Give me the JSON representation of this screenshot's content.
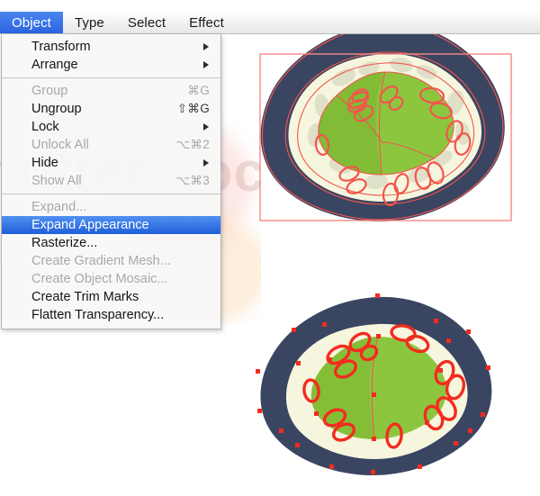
{
  "app": {
    "colors": {
      "menubar_highlight": "#2c63e0",
      "menu_selected": "#1f5fd8",
      "artwork_navy": "#3a4562",
      "artwork_cream": "#f6f6df",
      "artwork_green": "#8cc63f",
      "artwork_green_dark": "#7ab32e",
      "artwork_olive": "#dcddc4",
      "path_red": "#f4554c",
      "bbox_red": "#f58a85",
      "anchor_red": "#f42b1e"
    }
  },
  "menubar": {
    "items": [
      {
        "label": "Object",
        "active": true
      },
      {
        "label": "Type",
        "active": false
      },
      {
        "label": "Select",
        "active": false
      },
      {
        "label": "Effect",
        "active": false
      }
    ]
  },
  "object_menu": {
    "groups": [
      {
        "items": [
          {
            "label": "Transform",
            "shortcut": "",
            "submenu": true,
            "disabled": false,
            "selected": false
          },
          {
            "label": "Arrange",
            "shortcut": "",
            "submenu": true,
            "disabled": false,
            "selected": false
          }
        ]
      },
      {
        "items": [
          {
            "label": "Group",
            "shortcut": "⌘G",
            "submenu": false,
            "disabled": true,
            "selected": false
          },
          {
            "label": "Ungroup",
            "shortcut": "⇧⌘G",
            "submenu": false,
            "disabled": false,
            "selected": false
          },
          {
            "label": "Lock",
            "shortcut": "",
            "submenu": true,
            "disabled": false,
            "selected": false
          },
          {
            "label": "Unlock All",
            "shortcut": "⌥⌘2",
            "submenu": false,
            "disabled": true,
            "selected": false
          },
          {
            "label": "Hide",
            "shortcut": "",
            "submenu": true,
            "disabled": false,
            "selected": false
          },
          {
            "label": "Show All",
            "shortcut": "⌥⌘3",
            "submenu": false,
            "disabled": true,
            "selected": false
          }
        ]
      },
      {
        "items": [
          {
            "label": "Expand...",
            "shortcut": "",
            "submenu": false,
            "disabled": true,
            "selected": false
          },
          {
            "label": "Expand Appearance",
            "shortcut": "",
            "submenu": false,
            "disabled": false,
            "selected": true
          },
          {
            "label": "Rasterize...",
            "shortcut": "",
            "submenu": false,
            "disabled": false,
            "selected": false
          },
          {
            "label": "Create Gradient Mesh...",
            "shortcut": "",
            "submenu": false,
            "disabled": true,
            "selected": false
          },
          {
            "label": "Create Object Mosaic...",
            "shortcut": "",
            "submenu": false,
            "disabled": true,
            "selected": false
          },
          {
            "label": "Create Trim Marks",
            "shortcut": "",
            "submenu": false,
            "disabled": false,
            "selected": false
          },
          {
            "label": "Flatten Transparency...",
            "shortcut": "",
            "submenu": false,
            "disabled": false,
            "selected": false
          }
        ]
      }
    ]
  },
  "canvas": {
    "artwork_top": {
      "name": "sushi-roll-illustration-selected",
      "description": "Top-down sushi roll artwork with selection bounding box and live paths",
      "has_bounding_box": true,
      "has_anchor_points": false
    },
    "artwork_bottom": {
      "name": "sushi-roll-illustration-expanded",
      "description": "Same sushi roll artwork after Expand Appearance showing anchor points",
      "has_bounding_box": false,
      "has_anchor_points": true
    }
  },
  "watermark": {
    "text": "hutterstock"
  }
}
